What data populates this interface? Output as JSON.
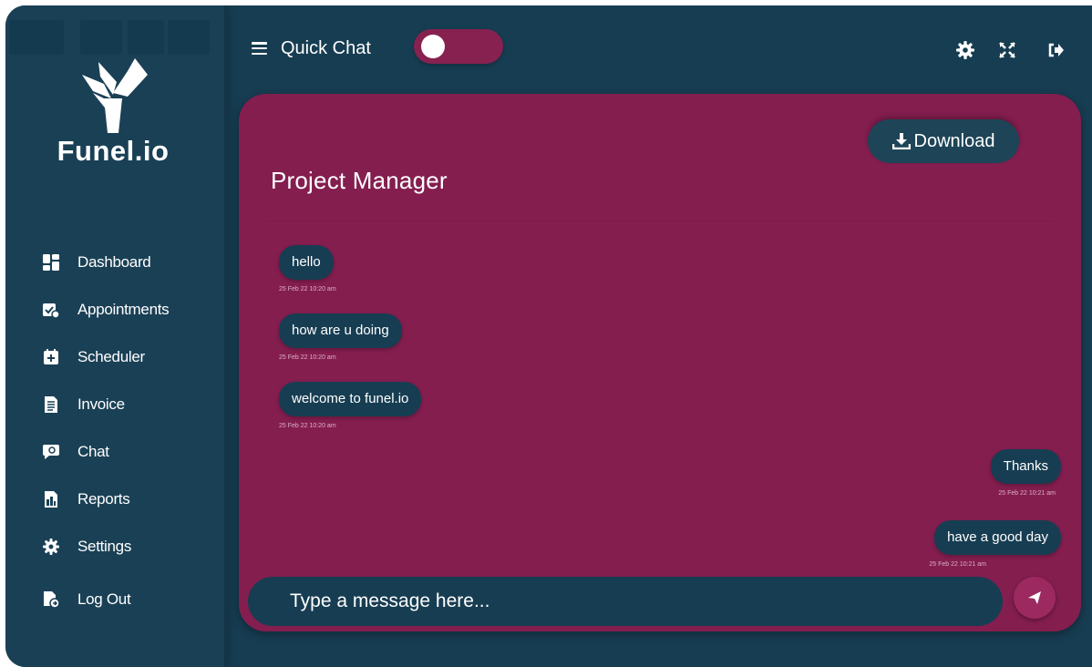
{
  "brand": {
    "name": "Funel.io"
  },
  "sidebar": {
    "items": [
      {
        "label": "Dashboard",
        "icon": "dashboard-icon"
      },
      {
        "label": "Appointments",
        "icon": "appointments-icon"
      },
      {
        "label": "Scheduler",
        "icon": "scheduler-icon"
      },
      {
        "label": "Invoice",
        "icon": "invoice-icon"
      },
      {
        "label": "Chat",
        "icon": "chat-icon"
      },
      {
        "label": "Reports",
        "icon": "reports-icon"
      },
      {
        "label": "Settings",
        "icon": "gear-icon"
      },
      {
        "label": "Log Out",
        "icon": "logout-icon"
      }
    ]
  },
  "topbar": {
    "quick_chat_label": "Quick Chat",
    "quick_chat_enabled": false,
    "icons": [
      "gear-icon",
      "fullscreen-icon",
      "sign-out-icon"
    ]
  },
  "chat": {
    "title": "Project Manager",
    "download_label": "Download",
    "messages": [
      {
        "text": "hello",
        "time": "25 Feb 22 10:20 am",
        "side": "left"
      },
      {
        "text": "how are u doing",
        "time": "25 Feb 22 10:20 am",
        "side": "left"
      },
      {
        "text": "welcome to funel.io",
        "time": "25 Feb 22 10:20 am",
        "side": "left"
      },
      {
        "text": "Thanks",
        "time": "25 Feb 22 10:21 am",
        "side": "right"
      },
      {
        "text": "have a good day",
        "time": "25 Feb 22 10:21 am",
        "side": "right"
      }
    ],
    "input_placeholder": "Type a message here..."
  },
  "colors": {
    "background": "#173d52",
    "sidebar": "#1a4055",
    "panel": "#841e4f",
    "bubble": "#173d52",
    "toggle": "#872150",
    "send_button": "#9c2960"
  }
}
